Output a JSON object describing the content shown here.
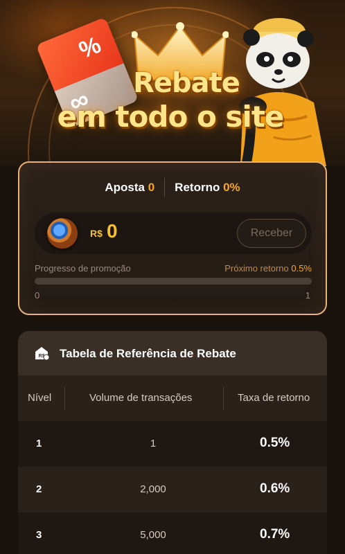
{
  "hero": {
    "title_line1": "Rebate",
    "title_line2": "em todo o site"
  },
  "stats": {
    "bet_label": "Aposta",
    "bet_value": "0",
    "return_label": "Retorno",
    "return_value": "0%"
  },
  "balance": {
    "currency": "R$",
    "amount": "0",
    "claim_button": "Receber"
  },
  "progress": {
    "label": "Progresso de promoção",
    "next_label": "Próximo retorno",
    "next_value": "0.5%",
    "min": "0",
    "max": "1",
    "fraction": 0
  },
  "table": {
    "title": "Tabela de Referência de Rebate",
    "icon": "rebate-badge-icon",
    "columns": [
      "Nível",
      "Volume de transações",
      "Taxa de retorno"
    ],
    "rows": [
      {
        "level": "1",
        "volume": "1",
        "rate": "0.5%"
      },
      {
        "level": "2",
        "volume": "2,000",
        "rate": "0.6%"
      },
      {
        "level": "3",
        "volume": "5,000",
        "rate": "0.7%"
      }
    ]
  },
  "colors": {
    "accent": "#f5a623",
    "gold": "#f5c030",
    "card_border": "#e8b27a",
    "background": "#1a130d"
  }
}
